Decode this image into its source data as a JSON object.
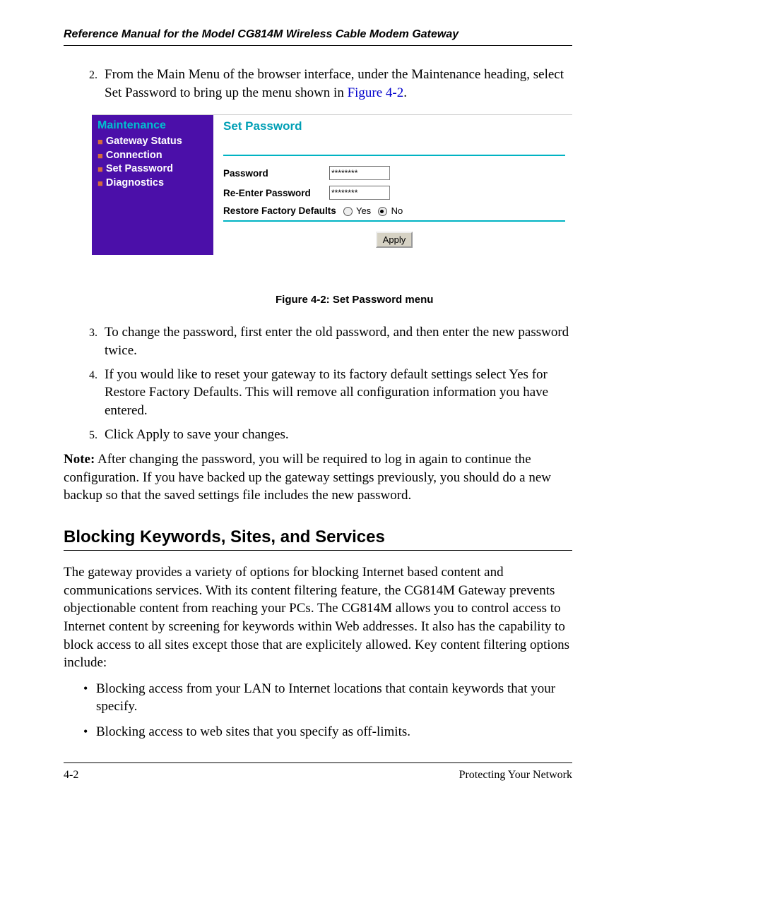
{
  "header": "Reference Manual for the Model CG814M Wireless Cable Modem Gateway",
  "steps_first": {
    "item2_a": "From the Main Menu of the browser interface, under the Maintenance heading, select Set Password to bring up the menu shown in ",
    "item2_link": "Figure 4-2",
    "item2_b": "."
  },
  "ui": {
    "sidebar": {
      "heading": "Maintenance",
      "items": [
        "Gateway Status",
        "Connection",
        "Set Password",
        "Diagnostics"
      ]
    },
    "panel": {
      "title": "Set Password",
      "password_label": "Password",
      "password_value": "********",
      "reenter_label": "Re-Enter Password",
      "reenter_value": "********",
      "restore_label": "Restore Factory Defaults",
      "opt_yes": "Yes",
      "opt_no": "No",
      "restore_selected": "No",
      "apply": "Apply"
    }
  },
  "figure_caption": "Figure 4-2: Set Password menu",
  "steps_second": {
    "item3": "To change the password, first enter the old password, and then enter the new password twice.",
    "item4": "If you would like to reset your gateway to its factory default settings select Yes for Restore Factory Defaults. This will remove all configuration information you have entered.",
    "item5": "Click Apply to save your changes."
  },
  "note": {
    "label": "Note:",
    "text": " After changing the password, you will be required to log in again to continue the configuration. If you have backed up the gateway settings previously, you should do a new backup so that the saved settings file includes the new password."
  },
  "section_heading": "Blocking Keywords, Sites, and Services",
  "section_body": "The gateway provides a variety of options for blocking Internet based content and communications services. With its content filtering feature, the CG814M Gateway prevents objectionable content from reaching your PCs. The CG814M allows you to control access to Internet content by screening for keywords within Web addresses. It also has the capability to block access to all sites except those that are explicitely allowed. Key content filtering options include:",
  "bullets": [
    "Blocking access from your LAN to Internet locations that contain keywords that your specify.",
    "Blocking access to web sites that you specify as off-limits."
  ],
  "footer": {
    "left": "4-2",
    "right": "Protecting Your Network"
  }
}
